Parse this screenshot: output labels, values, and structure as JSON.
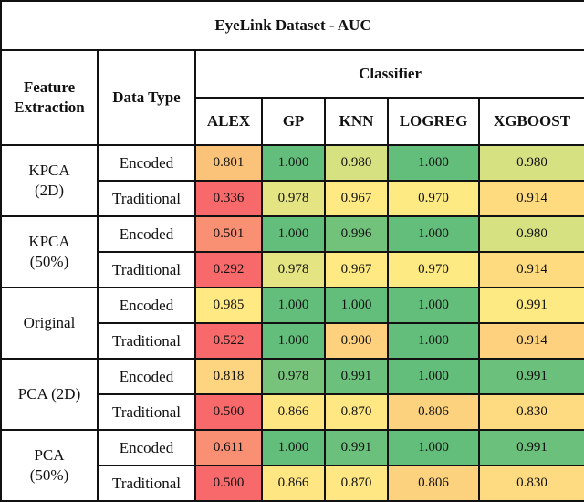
{
  "title": "EyeLink Dataset - AUC",
  "headers": {
    "feature_extraction": "Feature Extraction",
    "data_type": "Data Type",
    "classifier": "Classifier",
    "classifiers": [
      "ALEX",
      "GP",
      "KNN",
      "LOGREG",
      "XGBOOST"
    ]
  },
  "color_scale": {
    "low": "#f8696b",
    "mid": "#ffeb84",
    "high": "#63be7b"
  },
  "groups": [
    {
      "feature_extraction": "KPCA (2D)",
      "rows": [
        {
          "data_type": "Encoded",
          "values": [
            "0.801",
            "1.000",
            "0.980",
            "1.000",
            "0.980"
          ],
          "colors": [
            "#fbc27a",
            "#63be7b",
            "#d6e181",
            "#63be7b",
            "#d6e181"
          ]
        },
        {
          "data_type": "Traditional",
          "values": [
            "0.336",
            "0.978",
            "0.967",
            "0.970",
            "0.914"
          ],
          "colors": [
            "#f8696b",
            "#e4e482",
            "#fee983",
            "#feea83",
            "#fedb7f"
          ]
        }
      ]
    },
    {
      "feature_extraction": "KPCA (50%)",
      "rows": [
        {
          "data_type": "Encoded",
          "values": [
            "0.501",
            "1.000",
            "0.996",
            "1.000",
            "0.980"
          ],
          "colors": [
            "#f98f73",
            "#63be7b",
            "#72c27b",
            "#63be7b",
            "#d6e181"
          ]
        },
        {
          "data_type": "Traditional",
          "values": [
            "0.292",
            "0.978",
            "0.967",
            "0.970",
            "0.914"
          ],
          "colors": [
            "#f8696b",
            "#e4e482",
            "#fee983",
            "#feea83",
            "#fedb7f"
          ]
        }
      ]
    },
    {
      "feature_extraction": "Original",
      "rows": [
        {
          "data_type": "Encoded",
          "values": [
            "0.985",
            "1.000",
            "1.000",
            "1.000",
            "0.991"
          ],
          "colors": [
            "#fee983",
            "#63be7b",
            "#63be7b",
            "#63be7b",
            "#feea83"
          ]
        },
        {
          "data_type": "Traditional",
          "values": [
            "0.522",
            "1.000",
            "0.900",
            "1.000",
            "0.914"
          ],
          "colors": [
            "#f8696b",
            "#63be7b",
            "#fdd17e",
            "#63be7b",
            "#fdd17e"
          ]
        }
      ]
    },
    {
      "feature_extraction": "PCA (2D)",
      "rows": [
        {
          "data_type": "Encoded",
          "values": [
            "0.818",
            "0.978",
            "0.991",
            "1.000",
            "0.991"
          ],
          "colors": [
            "#fdd47f",
            "#78c37c",
            "#6bc17c",
            "#63be7b",
            "#6bc17c"
          ]
        },
        {
          "data_type": "Traditional",
          "values": [
            "0.500",
            "0.866",
            "0.870",
            "0.806",
            "0.830"
          ],
          "colors": [
            "#f8696b",
            "#fee683",
            "#ffe784",
            "#fcd27f",
            "#fedb80"
          ]
        }
      ]
    },
    {
      "feature_extraction": "PCA (50%)",
      "rows": [
        {
          "data_type": "Encoded",
          "values": [
            "0.611",
            "1.000",
            "0.991",
            "1.000",
            "0.991"
          ],
          "colors": [
            "#f98f73",
            "#63be7b",
            "#6bc17c",
            "#63be7b",
            "#6bc17c"
          ]
        },
        {
          "data_type": "Traditional",
          "values": [
            "0.500",
            "0.866",
            "0.870",
            "0.806",
            "0.830"
          ],
          "colors": [
            "#f8696b",
            "#fee683",
            "#ffe784",
            "#fcd27f",
            "#fedb80"
          ]
        }
      ]
    }
  ]
}
